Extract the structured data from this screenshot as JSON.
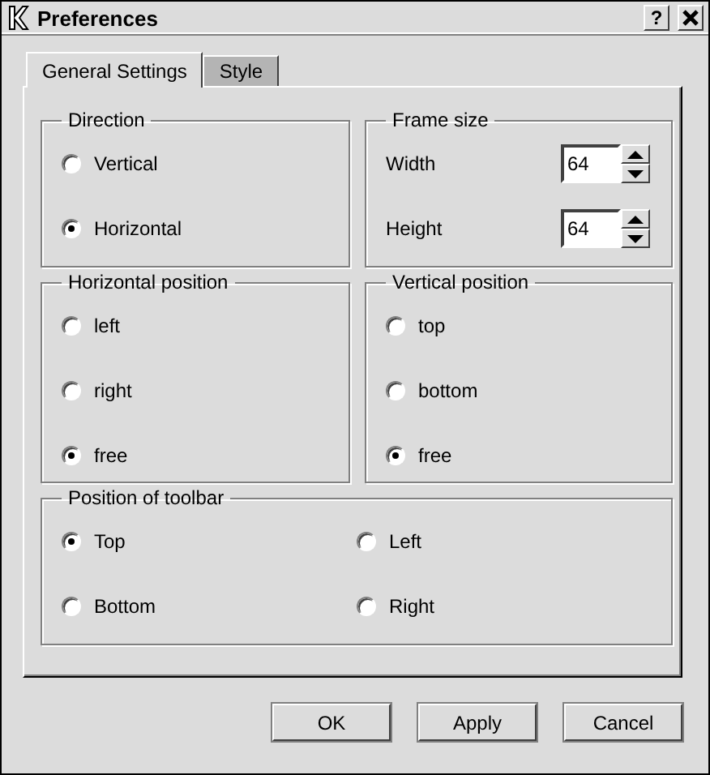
{
  "window": {
    "title": "Preferences",
    "help": "?"
  },
  "tabs": [
    {
      "label": "General Settings",
      "selected": true
    },
    {
      "label": "Style",
      "selected": false
    }
  ],
  "groups": [
    {
      "kind": "radio",
      "title": "Direction",
      "options": [
        {
          "label": "Vertical",
          "selected": false
        },
        {
          "label": "Horizontal",
          "selected": true
        }
      ]
    },
    {
      "kind": "spin",
      "title": "Frame size",
      "fields": [
        {
          "label": "Width",
          "value": "64"
        },
        {
          "label": "Height",
          "value": "64"
        }
      ]
    },
    {
      "kind": "radio",
      "title": "Horizontal position",
      "options": [
        {
          "label": "left",
          "selected": false
        },
        {
          "label": "right",
          "selected": false
        },
        {
          "label": "free",
          "selected": true
        }
      ]
    },
    {
      "kind": "radio",
      "title": "Vertical position",
      "options": [
        {
          "label": "top",
          "selected": false
        },
        {
          "label": "bottom",
          "selected": false
        },
        {
          "label": "free",
          "selected": true
        }
      ]
    },
    {
      "kind": "radio-grid",
      "title": "Position of toolbar",
      "options": [
        {
          "label": "Top",
          "selected": true
        },
        {
          "label": "Left",
          "selected": false
        },
        {
          "label": "Bottom",
          "selected": false
        },
        {
          "label": "Right",
          "selected": false
        }
      ]
    }
  ],
  "buttons": [
    "OK",
    "Apply",
    "Cancel"
  ]
}
